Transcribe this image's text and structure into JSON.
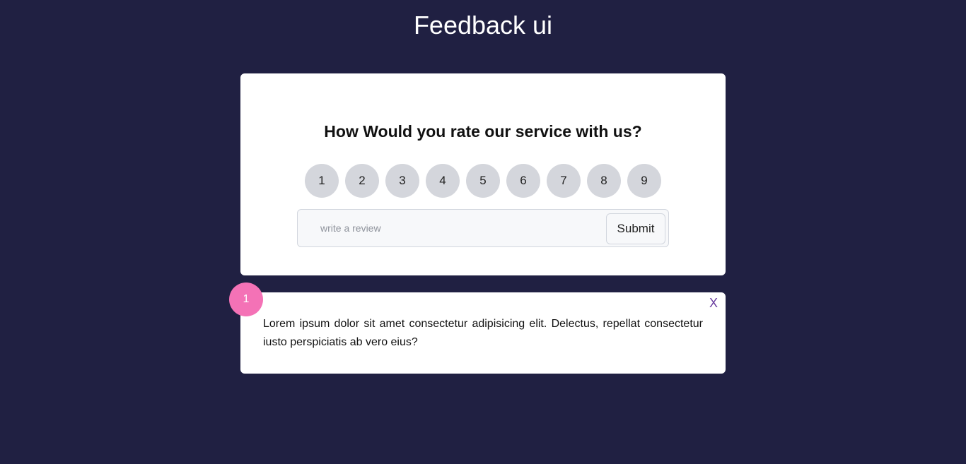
{
  "header": {
    "title": "Feedback ui"
  },
  "rating_card": {
    "question": "How Would you rate our service with us?",
    "ratings": [
      "1",
      "2",
      "3",
      "4",
      "5",
      "6",
      "7",
      "8",
      "9"
    ],
    "review_input": {
      "value": "",
      "placeholder": "write a review"
    },
    "submit_label": "Submit"
  },
  "feedback_list": [
    {
      "rating": "1",
      "close_label": "X",
      "text": "Lorem ipsum dolor sit amet consectetur adipisicing elit. Delectus, repellat consectetur iusto perspiciatis ab vero eius?"
    }
  ],
  "colors": {
    "background": "#202042",
    "card": "#ffffff",
    "rating_circle": "#d4d6dc",
    "badge": "#f472b6",
    "close_icon": "#6b3fa0"
  }
}
